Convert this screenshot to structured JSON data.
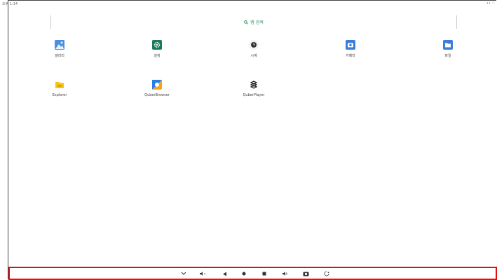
{
  "status": {
    "time": "오후 1:14",
    "right": "•• ♡"
  },
  "search": {
    "label": "앱 검색"
  },
  "apps": [
    {
      "name": "gallery",
      "label": "갤러리"
    },
    {
      "name": "settings",
      "label": "설정"
    },
    {
      "name": "clock",
      "label": "시계"
    },
    {
      "name": "camera",
      "label": "카메라"
    },
    {
      "name": "files",
      "label": "파일"
    },
    {
      "name": "explorer",
      "label": "Explorer"
    },
    {
      "name": "quberbrowser",
      "label": "QuberBrowser"
    },
    {
      "name": "quberplayer",
      "label": "QuberPlayer"
    }
  ],
  "navbar": [
    "chevron-down-icon",
    "volume-down-icon",
    "back-icon",
    "home-icon",
    "recents-icon",
    "volume-up-icon",
    "screenshot-icon",
    "rotate-icon"
  ],
  "colors": {
    "accent": "#1f8a52",
    "highlight_border": "#e01010"
  }
}
